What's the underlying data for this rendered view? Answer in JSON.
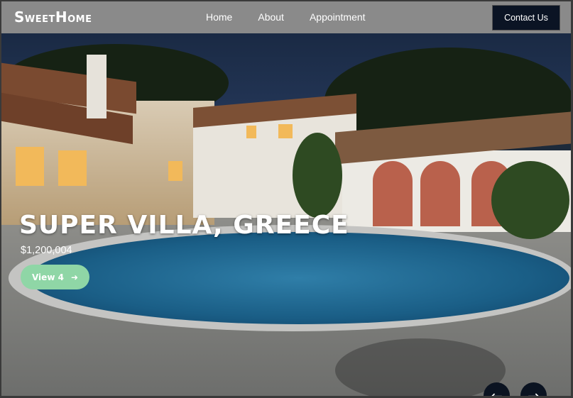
{
  "brand": {
    "logo_s": "S",
    "logo_weet": "WEET",
    "logo_h": "H",
    "logo_ome": "OME"
  },
  "nav": [
    {
      "label": "Home"
    },
    {
      "label": "About"
    },
    {
      "label": "Appointment"
    }
  ],
  "header": {
    "contact_label": "Contact Us"
  },
  "hero": {
    "title": "SUPER VILLA, GREECE",
    "price": "$1,200,004",
    "view_label": "View 4",
    "view_icon": "arrow-right-icon",
    "prev_icon": "arrow-left-icon",
    "next_icon": "arrow-right-icon"
  },
  "colors": {
    "header_bg": "#8a8a8a",
    "contact_bg": "#0b1424",
    "view_button": "#8fd6a6",
    "arrow_button": "#0b1321"
  }
}
